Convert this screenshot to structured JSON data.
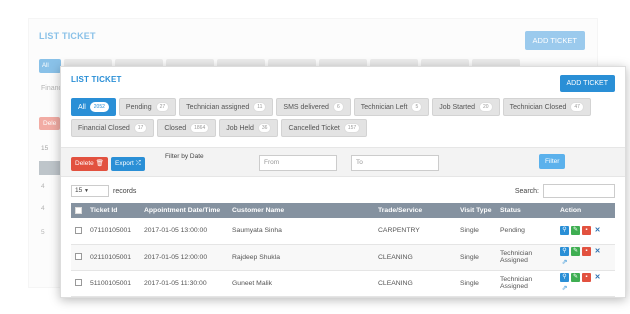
{
  "background": {
    "title": "LIST TICKET",
    "add_label": "ADD TICKET",
    "active_tab": "All",
    "partial_label": "Financ",
    "delete_label": "Dele",
    "length_value": "15",
    "row_marks": [
      "4",
      "4",
      "5"
    ]
  },
  "header": {
    "title": "LIST TICKET",
    "add_label": "ADD TICKET"
  },
  "tabs": [
    {
      "label": "All",
      "count": "2052"
    },
    {
      "label": "Pending",
      "count": "27"
    },
    {
      "label": "Technician assigned",
      "count": "11"
    },
    {
      "label": "SMS delivered",
      "count": "6"
    },
    {
      "label": "Technician Left",
      "count": "5"
    },
    {
      "label": "Job Started",
      "count": "20"
    },
    {
      "label": "Technician Closed",
      "count": "47"
    },
    {
      "label": "Financial Closed",
      "count": "17"
    },
    {
      "label": "Closed",
      "count": "1864"
    },
    {
      "label": "Job Held",
      "count": "36"
    },
    {
      "label": "Cancelled Ticket",
      "count": "157"
    }
  ],
  "toolbar": {
    "delete_label": "Delete 🗑",
    "export_label": "Export ⤮",
    "filter_label": "Filter by Date",
    "from_placeholder": "From",
    "to_placeholder": "To",
    "filter_button": "Filter"
  },
  "length": {
    "value": "15",
    "suffix": "records"
  },
  "search": {
    "label": "Search:",
    "value": ""
  },
  "table": {
    "columns": [
      "Ticket Id",
      "Appointment Date/Time",
      "Customer Name",
      "Trade/Service",
      "Visit Type",
      "Status",
      "Action"
    ],
    "rows": [
      {
        "id": "07110105001",
        "datetime": "2017-01-05 13:00:00",
        "customer": "Saumyata Sinha",
        "trade": "CARPENTRY",
        "visit": "Single",
        "status": "Pending"
      },
      {
        "id": "02110105001",
        "datetime": "2017-01-05 12:00:00",
        "customer": "Rajdeep Shukla",
        "trade": "CLEANING",
        "visit": "Single",
        "status": "Technician Assigned"
      },
      {
        "id": "51100105001",
        "datetime": "2017-01-05 11:30:00",
        "customer": "Guneet Malik",
        "trade": "CLEANING",
        "visit": "Single",
        "status": "Technician Assigned"
      }
    ]
  },
  "colors": {
    "accent": "#2a8fd6",
    "danger": "#e2513f",
    "success": "#3fae52",
    "table_header": "#8592a0"
  }
}
